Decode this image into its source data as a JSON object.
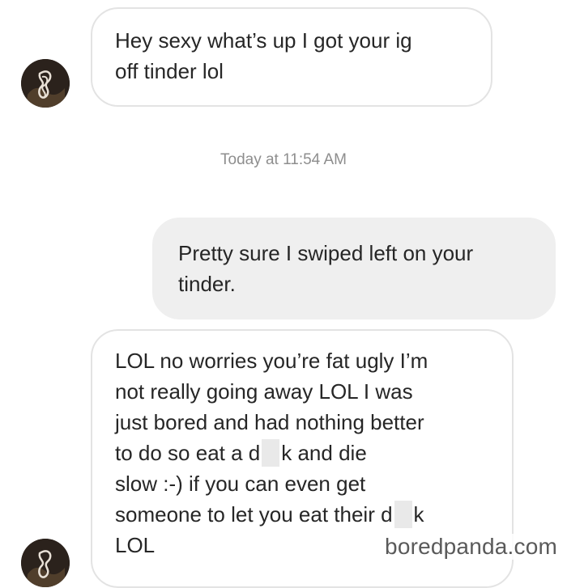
{
  "conversation": {
    "messages": [
      {
        "direction": "incoming",
        "text": "Hey sexy what’s up I got your ig\noff tinder lol"
      },
      {
        "direction": "outgoing",
        "text": "Pretty sure I swiped left on your\ntinder."
      },
      {
        "direction": "incoming",
        "text_parts": [
          "LOL no worries you’re fat ugly I’m\nnot really going away LOL I was\njust bored and had nothing better\nto do so eat a d",
          "k and die\nslow :-) if you can even get\nsomeone to let you eat their d",
          "k\nLOL"
        ]
      }
    ],
    "timestamp": "Today at 11:54 AM"
  },
  "watermark": "boredpanda.com",
  "colors": {
    "incoming_bg": "#ffffff",
    "incoming_border": "#e3e3e3",
    "outgoing_bg": "#efefef",
    "timestamp_text": "#8e8e8e",
    "censor_block": "#e9e9e9"
  },
  "icons": {
    "avatar": "scribbled-profile-avatar"
  }
}
